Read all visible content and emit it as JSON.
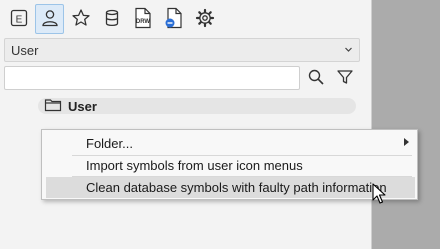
{
  "toolbar": {
    "tabs": [
      {
        "icon": "e-letter-icon",
        "label": "E"
      },
      {
        "icon": "user-icon",
        "active": true
      },
      {
        "icon": "star-icon"
      },
      {
        "icon": "database-icon"
      },
      {
        "icon": "drw-file-icon",
        "label": "DRW"
      },
      {
        "icon": "document-link-icon"
      },
      {
        "icon": "gear-icon"
      }
    ]
  },
  "dropdown": {
    "selected": "User"
  },
  "search": {
    "placeholder": ""
  },
  "tree": {
    "root_label": "User"
  },
  "context_menu": {
    "items": [
      {
        "label": "Folder...",
        "has_submenu": true
      },
      {
        "label": "Import symbols from user icon menus"
      },
      {
        "label": "Clean database symbols with faulty path information",
        "hovered": true
      }
    ]
  },
  "colors": {
    "active_tab": "#dceaf8",
    "panel_bg": "#f3f3f3",
    "hover": "#dcdcdc",
    "gray_area": "#ababab"
  }
}
